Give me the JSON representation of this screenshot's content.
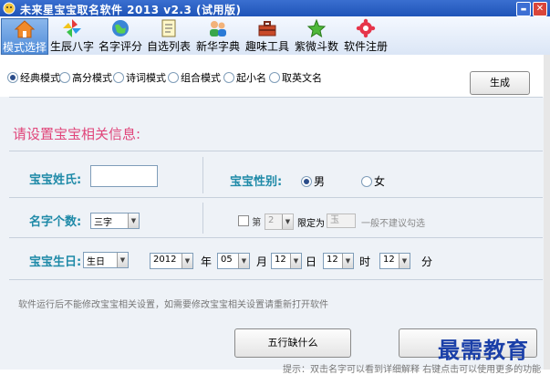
{
  "window": {
    "title": "未来星宝宝取名软件  2013  v2.3 (试用版)",
    "minimize_glyph": "▬",
    "close_glyph": "✕"
  },
  "toolbar": {
    "items": [
      {
        "label": "模式选择",
        "icon": "house-icon",
        "active": true
      },
      {
        "label": "生辰八字",
        "icon": "pinwheel-icon"
      },
      {
        "label": "名字评分",
        "icon": "globe-icon"
      },
      {
        "label": "自选列表",
        "icon": "notes-icon"
      },
      {
        "label": "新华字典",
        "icon": "people-icon"
      },
      {
        "label": "趣味工具",
        "icon": "toolbox-icon"
      },
      {
        "label": "紫微斗数",
        "icon": "stars-icon"
      },
      {
        "label": "软件注册",
        "icon": "gear-icon"
      }
    ]
  },
  "modes": {
    "options": [
      "经典模式",
      "高分模式",
      "诗词模式",
      "组合模式",
      "起小名",
      "取英文名"
    ],
    "selected": 0,
    "generate_label": "生成"
  },
  "form": {
    "section_title": "请设置宝宝相关信息:",
    "surname_label": "宝宝姓氏:",
    "surname_value": "",
    "gender_label": "宝宝性别:",
    "gender_options": [
      "男",
      "女"
    ],
    "gender_selected": 0,
    "name_count_label": "名字个数:",
    "name_count_value": "三字",
    "position_prefix": "第",
    "position_value": "2",
    "limit_label": "限定为",
    "limit_value": "玉",
    "limit_note": "一般不建议勾选",
    "birthday_label": "宝宝生日:",
    "calendar_value": "生日",
    "year_value": "2012",
    "year_unit": "年",
    "month_value": "05",
    "month_unit": "月",
    "day_value": "12",
    "day_unit": "日",
    "hour_value": "12",
    "hour_unit": "时",
    "minute_value": "12",
    "minute_unit": "分",
    "restart_note": "软件运行后不能修改宝宝相关设置，如需要修改宝宝相关设置请重新打开软件",
    "wuxing_button": "五行缺什么",
    "hint": "提示：双击名字可以看到详细解释    右键点击可以使用更多的功能",
    "watermark": "最需教育"
  }
}
